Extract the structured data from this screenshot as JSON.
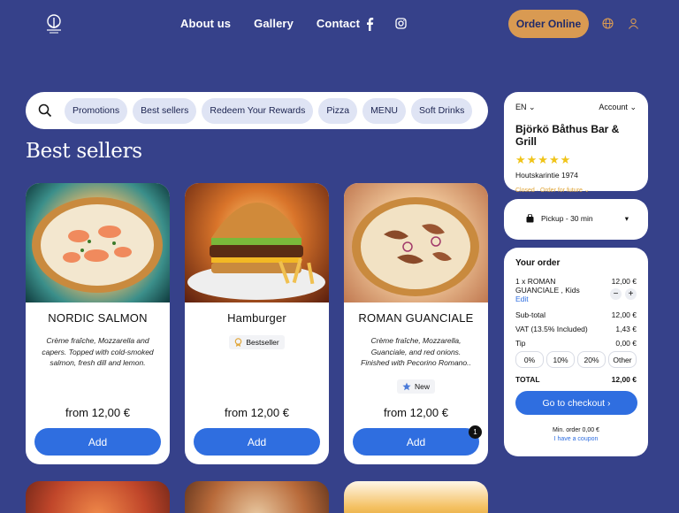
{
  "header": {
    "nav": [
      "About us",
      "Gallery",
      "Contact"
    ],
    "order_online": "Order Online"
  },
  "categories": {
    "chips": [
      "Promotions",
      "Best sellers",
      "Redeem Your Rewards",
      "Pizza",
      "MENU",
      "Soft Drinks"
    ]
  },
  "section_title": "Best sellers",
  "products": [
    {
      "name": "NORDIC SALMON",
      "description": "Crème fraîche, Mozzarella and capers. Topped with cold-smoked salmon, fresh dill and lemon.",
      "price": "from 12,00 €",
      "add_label": "Add"
    },
    {
      "name": "Hamburger",
      "badge": "Bestseller",
      "price": "from 12,00 €",
      "add_label": "Add"
    },
    {
      "name": "ROMAN GUANCIALE",
      "description": "Crème fraîche, Mozzarella, Guanciale, and red onions. Finished with Pecorino Romano..",
      "badge": "New",
      "price": "from 12,00 €",
      "add_label": "Add",
      "cart_count": "1"
    }
  ],
  "restaurant": {
    "language": "EN",
    "account": "Account",
    "name": "Björkö Båthus Bar & Grill",
    "stars": "★★★★★",
    "address": "Houtskarintie 1974",
    "status": "Closed · Order for future"
  },
  "pickup": {
    "label": "Pickup - 30 min"
  },
  "order": {
    "title": "Your order",
    "item": {
      "name": "1 x ROMAN GUANCIALE , Kids",
      "price": "12,00 €",
      "edit": "Edit",
      "minus": "−",
      "plus": "+"
    },
    "subtotal_label": "Sub-total",
    "subtotal": "12,00 €",
    "vat_label": "VAT (13.5% Included)",
    "vat": "1,43 €",
    "tip_label": "Tip",
    "tip": "0,00 €",
    "tip_options": [
      "0%",
      "10%",
      "20%",
      "Other"
    ],
    "total_label": "TOTAL",
    "total": "12,00 €",
    "checkout": "Go to checkout",
    "min_order": "Min. order 0,00 €",
    "coupon": "I have a coupon"
  },
  "colors": {
    "background": "#36418a",
    "accent": "#2f6ee0",
    "order_button": "#d99a52",
    "star": "#f0c419"
  }
}
